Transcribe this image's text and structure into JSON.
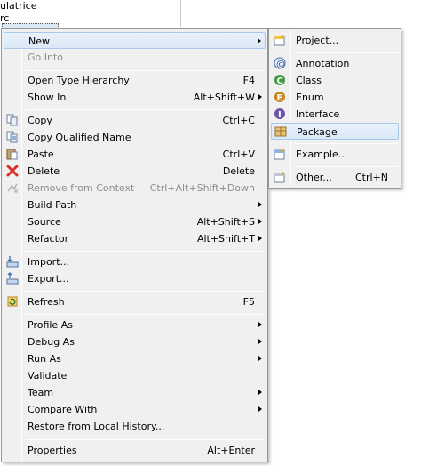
{
  "tree": {
    "line1": "ulatrice",
    "line2": "rc"
  },
  "menu": {
    "items": [
      {
        "label": "New",
        "shortcut": "",
        "submenu": true,
        "highlighted": true
      },
      {
        "label": "Go Into",
        "shortcut": "",
        "disabled": true
      },
      {
        "label": "Open Type Hierarchy",
        "shortcut": "F4"
      },
      {
        "label": "Show In",
        "shortcut": "Alt+Shift+W",
        "submenu": true
      },
      {
        "label": "Copy",
        "shortcut": "Ctrl+C",
        "icon": "copy-icon"
      },
      {
        "label": "Copy Qualified Name",
        "shortcut": "",
        "icon": "copy-qualified-icon"
      },
      {
        "label": "Paste",
        "shortcut": "Ctrl+V",
        "icon": "paste-icon"
      },
      {
        "label": "Delete",
        "shortcut": "Delete",
        "icon": "delete-icon"
      },
      {
        "label": "Remove from Context",
        "shortcut": "Ctrl+Alt+Shift+Down",
        "disabled": true,
        "icon": "remove-context-icon"
      },
      {
        "label": "Build Path",
        "shortcut": "",
        "submenu": true
      },
      {
        "label": "Source",
        "shortcut": "Alt+Shift+S",
        "submenu": true
      },
      {
        "label": "Refactor",
        "shortcut": "Alt+Shift+T",
        "submenu": true
      },
      {
        "label": "Import...",
        "shortcut": "",
        "icon": "import-icon"
      },
      {
        "label": "Export...",
        "shortcut": "",
        "icon": "export-icon"
      },
      {
        "label": "Refresh",
        "shortcut": "F5",
        "icon": "refresh-icon"
      },
      {
        "label": "Profile As",
        "shortcut": "",
        "submenu": true
      },
      {
        "label": "Debug As",
        "shortcut": "",
        "submenu": true
      },
      {
        "label": "Run As",
        "shortcut": "",
        "submenu": true
      },
      {
        "label": "Validate",
        "shortcut": ""
      },
      {
        "label": "Team",
        "shortcut": "",
        "submenu": true
      },
      {
        "label": "Compare With",
        "shortcut": "",
        "submenu": true
      },
      {
        "label": "Restore from Local History...",
        "shortcut": ""
      },
      {
        "label": "Properties",
        "shortcut": "Alt+Enter"
      }
    ]
  },
  "submenu": {
    "items": [
      {
        "label": "Project...",
        "shortcut": "",
        "icon": "project-icon"
      },
      {
        "label": "Annotation",
        "shortcut": "",
        "icon": "annotation-icon"
      },
      {
        "label": "Class",
        "shortcut": "",
        "icon": "class-icon"
      },
      {
        "label": "Enum",
        "shortcut": "",
        "icon": "enum-icon"
      },
      {
        "label": "Interface",
        "shortcut": "",
        "icon": "interface-icon"
      },
      {
        "label": "Package",
        "shortcut": "",
        "icon": "package-icon",
        "highlighted": true
      },
      {
        "label": "Example...",
        "shortcut": "",
        "icon": "example-icon"
      },
      {
        "label": "Other...",
        "shortcut": "Ctrl+N",
        "icon": "other-icon"
      }
    ]
  },
  "colors": {
    "menu_bg": "#f0f0f0",
    "highlight_border": "#a8c8ec",
    "disabled_text": "#8d8d8d",
    "delete_red": "#d9302a",
    "class_green": "#3f9b3f",
    "enum_orange": "#c7871e",
    "interface_purple": "#6e55a8",
    "package_tan": "#c9a050"
  }
}
